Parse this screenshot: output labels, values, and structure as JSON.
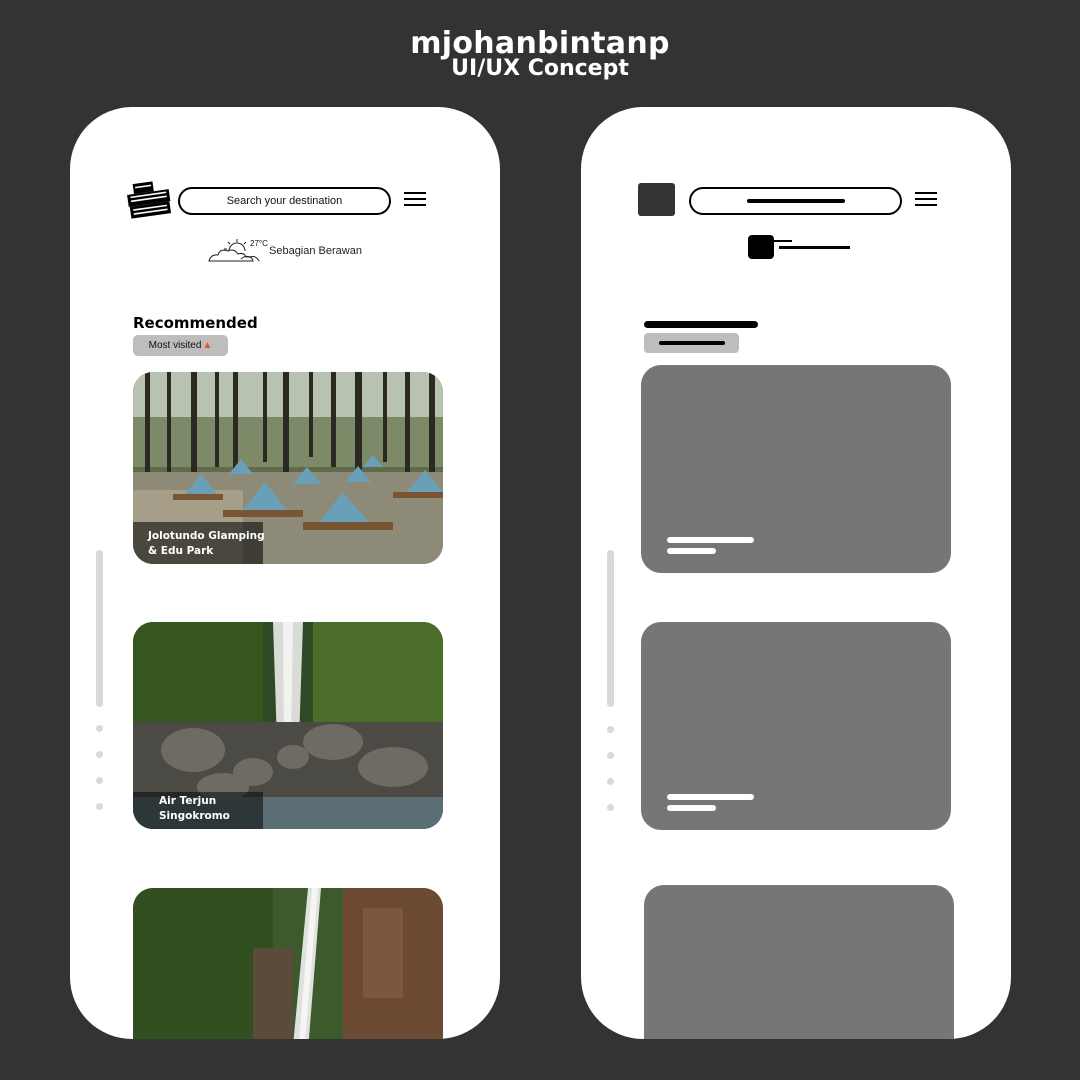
{
  "header": {
    "title": "mjohanbintanp",
    "subtitle": "UI/UX Concept"
  },
  "left_screen": {
    "logo_text": "LET'S EXPLORE NGANJUK",
    "search": {
      "placeholder": "Search your destination"
    },
    "menu_icon": "hamburger-icon",
    "weather": {
      "icon": "partly-cloudy-icon",
      "temperature": "27°C",
      "condition": "Sebagian Berawan"
    },
    "section_title": "Recommended",
    "filter_tag": {
      "label": "Most visited",
      "icon": "fire-icon"
    },
    "cards": [
      {
        "name_line1": "Jolotundo Glamping",
        "name_line2": "& Edu Park",
        "image": "forest-glamping-photo"
      },
      {
        "name_line1": "Air Terjun",
        "name_line2": "Singokromo",
        "image": "waterfall-photo"
      },
      {
        "name_line1": "",
        "name_line2": "",
        "image": "cliff-waterfall-photo"
      }
    ]
  },
  "right_screen": {
    "variant": "wireframe-skeleton",
    "colors": {
      "placeholder": "#767676",
      "tag": "#bdbdbd",
      "line": "#000000"
    }
  },
  "colors": {
    "background": "#333333",
    "phone": "#ffffff",
    "scroll": "#d9d9d9"
  }
}
